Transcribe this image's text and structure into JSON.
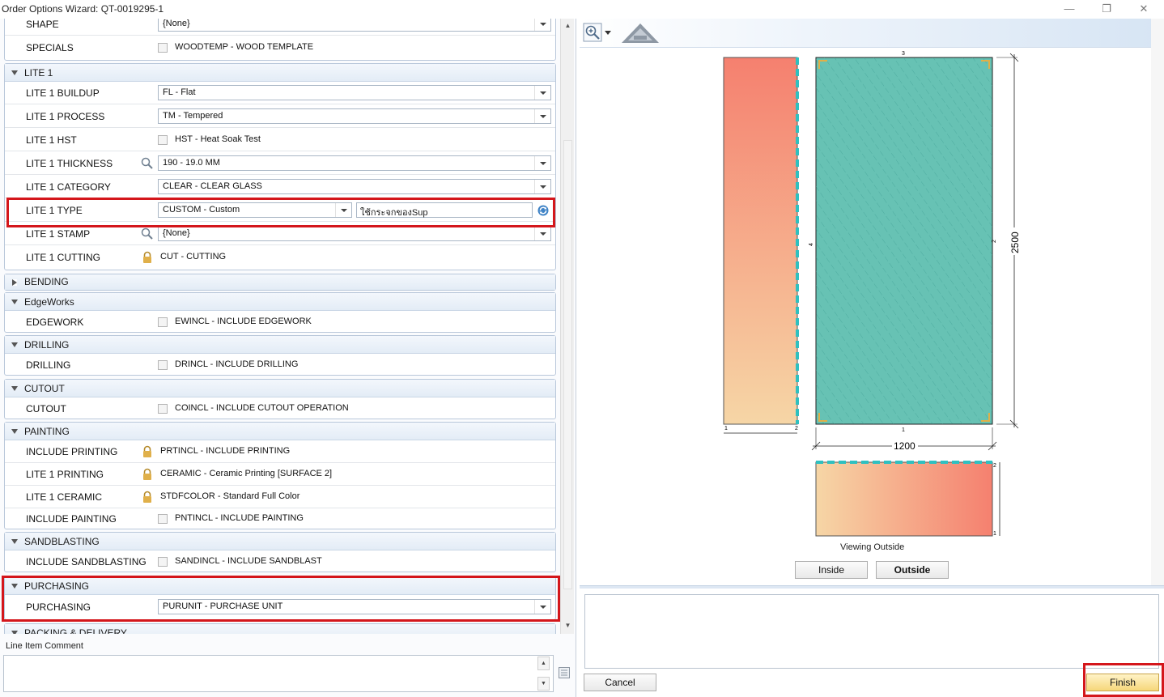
{
  "window": {
    "title": "Order Options Wizard: QT-0019295-1",
    "minimize": "—",
    "restore": "❐",
    "close": "✕"
  },
  "rows_top": {
    "shape": {
      "label": "SHAPE",
      "value": "{None}"
    },
    "specials": {
      "label": "SPECIALS",
      "value": "WOODTEMP - WOOD TEMPLATE"
    }
  },
  "lite1": {
    "header": "LITE 1",
    "buildup": {
      "label": "LITE 1 BUILDUP",
      "value": "FL - Flat"
    },
    "process": {
      "label": "LITE 1 PROCESS",
      "value": "TM - Tempered"
    },
    "hst": {
      "label": "LITE 1 HST",
      "value": "HST - Heat Soak Test"
    },
    "thickness": {
      "label": "LITE 1 THICKNESS",
      "value": "190 - 19.0 MM"
    },
    "category": {
      "label": "LITE 1 CATEGORY",
      "value": "CLEAR - CLEAR GLASS"
    },
    "type": {
      "label": "LITE 1 TYPE",
      "value": "CUSTOM - Custom",
      "custom_text": "ใช้กระจกของSup"
    },
    "stamp": {
      "label": "LITE 1 STAMP",
      "value": "{None}"
    },
    "cutting": {
      "label": "LITE 1 CUTTING",
      "value": "CUT - CUTTING"
    }
  },
  "bending": {
    "header": "BENDING"
  },
  "edgeworks": {
    "header": "EdgeWorks",
    "edgework": {
      "label": "EDGEWORK",
      "value": "EWINCL - INCLUDE EDGEWORK"
    }
  },
  "drilling": {
    "header": "DRILLING",
    "drilling": {
      "label": "DRILLING",
      "value": "DRINCL - INCLUDE DRILLING"
    }
  },
  "cutout": {
    "header": "CUTOUT",
    "cutout": {
      "label": "CUTOUT",
      "value": "COINCL - INCLUDE CUTOUT OPERATION"
    }
  },
  "painting": {
    "header": "PAINTING",
    "include_printing": {
      "label": "INCLUDE PRINTING",
      "value": "PRTINCL - INCLUDE PRINTING"
    },
    "lite1_printing": {
      "label": "LITE 1 PRINTING",
      "value": "CERAMIC - Ceramic Printing [SURFACE 2]"
    },
    "lite1_ceramic": {
      "label": "LITE 1 CERAMIC",
      "value": "STDFCOLOR - Standard Full Color"
    },
    "include_painting": {
      "label": "INCLUDE PAINTING",
      "value": "PNTINCL - INCLUDE PAINTING"
    }
  },
  "sandblasting": {
    "header": "SANDBLASTING",
    "include": {
      "label": "INCLUDE SANDBLASTING",
      "value": "SANDINCL - INCLUDE SANDBLAST"
    }
  },
  "purchasing": {
    "header": "PURCHASING",
    "purchasing": {
      "label": "PURCHASING",
      "value": "PURUNIT - PURCHASE UNIT"
    }
  },
  "packing": {
    "header": "PACKING & DELIVERY"
  },
  "comment": {
    "label": "Line Item Comment",
    "value": ""
  },
  "drawing": {
    "width_dim": "1200",
    "height_dim": "2500",
    "edge_top": "3",
    "edge_right": "2",
    "edge_bottom": "1",
    "edge_left": "4",
    "side_small_1": "1",
    "side_small_2": "2",
    "bottom_small_2": "2",
    "bottom_small_1": "1",
    "viewing": "Viewing Outside",
    "colors": {
      "glass": "#5fbfb0",
      "edge": "#2fc0c0",
      "gradient_a": "#f6d6a6",
      "gradient_b": "#f5806f"
    }
  },
  "buttons": {
    "inside": "Inside",
    "outside": "Outside",
    "cancel": "Cancel",
    "finish": "Finish"
  },
  "highlight_color": "#d4161b"
}
